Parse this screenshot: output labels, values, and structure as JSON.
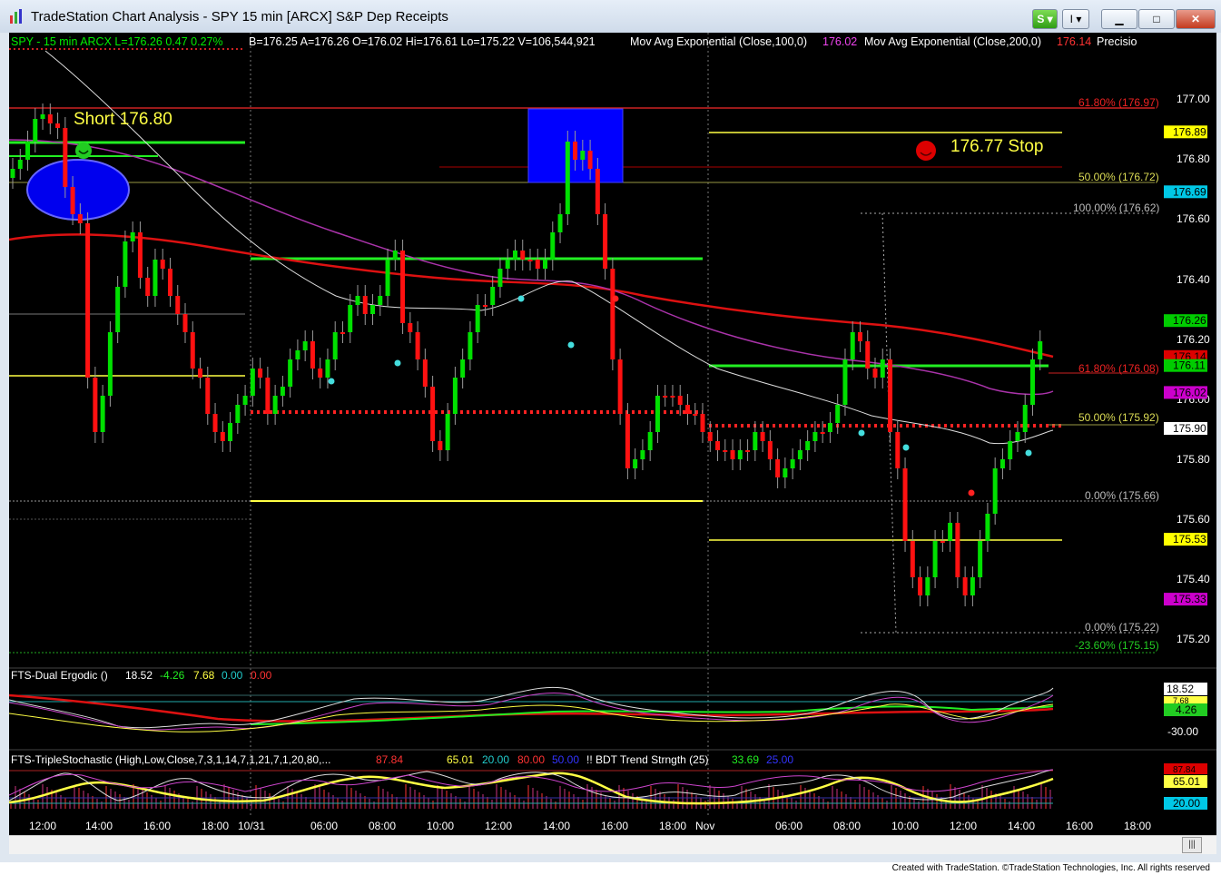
{
  "window": {
    "title": "TradeStation Chart Analysis - SPY 15 min [ARCX] S&P Dep Receipts",
    "buttons": {
      "s_label": "S",
      "i_label": "I"
    }
  },
  "header": {
    "symbol": "SPY - 15 min  ARCX  L=176.26  0.47  0.27%",
    "quote": "B=176.25  A=176.26  O=176.02  Hi=176.61  Lo=175.22  V=106,544,921",
    "ma100_label": "Mov Avg Exponential (Close,100,0)",
    "ma100_value": "176.02",
    "ma200_label": "Mov Avg Exponential (Close,200,0)",
    "ma200_value": "176.14",
    "precision": "Precisio"
  },
  "annotations": {
    "short": "Short  176.80",
    "stop": "176.77 Stop"
  },
  "fib_labels": [
    "61.80% (176.97)",
    "50.00% (176.72)",
    "100.00% (176.62)",
    "61.80% (176.08)",
    "50.00% (175.92)",
    "0.00% (175.66)",
    "0.00% (175.22)",
    "-23.60% (175.15)"
  ],
  "price_axis": {
    "ticks": [
      "177.00",
      "176.80",
      "176.60",
      "176.40",
      "176.20",
      "176.00",
      "175.80",
      "175.60",
      "175.40",
      "175.20"
    ],
    "badges": [
      {
        "text": "176.89",
        "bg": "#ffff00",
        "fg": "#000000"
      },
      {
        "text": "176.69",
        "bg": "#00c8e6",
        "fg": "#000000"
      },
      {
        "text": "176.26",
        "bg": "#00cc00",
        "fg": "#000000"
      },
      {
        "text": "176.14",
        "bg": "#dd0000",
        "fg": "#000000"
      },
      {
        "text": "176.11",
        "bg": "#00cc00",
        "fg": "#000000"
      },
      {
        "text": "176.02",
        "bg": "#cc00cc",
        "fg": "#000000"
      },
      {
        "text": "175.90",
        "bg": "#ffffff",
        "fg": "#000000"
      },
      {
        "text": "175.53",
        "bg": "#ffff00",
        "fg": "#000000"
      },
      {
        "text": "175.33",
        "bg": "#cc00cc",
        "fg": "#000000"
      }
    ]
  },
  "ergodic": {
    "label": "FTS-Dual Ergodic ()",
    "v1": "18.52",
    "v2": "-4.26",
    "v3": "7.68",
    "v4": "0.00",
    "v5": "0.00",
    "axis": [
      "18.52",
      "7.68",
      "4.26",
      "-30.00"
    ]
  },
  "stoch": {
    "label": "FTS-TripleStochastic (High,Low,Close,7,3,1,14,7,1,21,7,1,20,80,...",
    "v1": "87.84",
    "v2": "65.01",
    "v3": "20.00",
    "v4": "80.00",
    "v5": "50.00",
    "bdt_label": "!!  BDT Trend Strngth (25)",
    "bdt1": "33.69",
    "bdt2": "25.00",
    "axis": [
      "87.84",
      "65.01",
      "20.00"
    ]
  },
  "time_axis": [
    "12:00",
    "14:00",
    "16:00",
    "18:00",
    "10/31",
    "06:00",
    "08:00",
    "10:00",
    "12:00",
    "14:00",
    "16:00",
    "18:00",
    "Nov",
    "06:00",
    "08:00",
    "10:00",
    "12:00",
    "14:00",
    "16:00",
    "18:00"
  ],
  "footer": "Created with TradeStation. ©TradeStation Technologies, Inc. All rights reserved",
  "colors": {
    "background": "#000000",
    "up": "#00e000",
    "down": "#ff0000",
    "ma100": "#cc44cc",
    "ma200": "#dd1111",
    "fib": "#cc2222",
    "level": "#ffff44",
    "green_level": "#22ee22"
  }
}
